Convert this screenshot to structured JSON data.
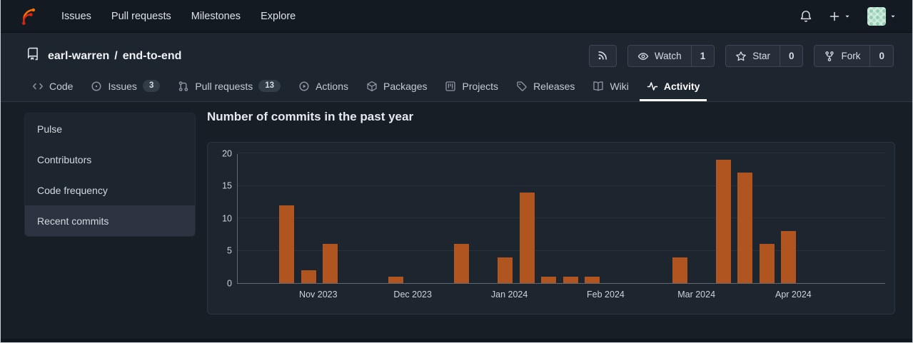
{
  "navbar": {
    "logo_icon": "forgejo-logo-icon",
    "links": [
      {
        "label": "Issues"
      },
      {
        "label": "Pull requests"
      },
      {
        "label": "Milestones"
      },
      {
        "label": "Explore"
      }
    ],
    "right": {
      "bell_icon": "bell-icon",
      "plus_icon": "plus-icon",
      "caret_icon": "chevron-down-icon"
    }
  },
  "repo": {
    "icon": "repo-icon",
    "owner": "earl-warren",
    "divider": "/",
    "name": "end-to-end"
  },
  "repo_actions": {
    "rss_icon": "rss-icon",
    "buttons": [
      {
        "label": "Watch",
        "count": "1",
        "icon": "eye-icon"
      },
      {
        "label": "Star",
        "count": "0",
        "icon": "star-icon"
      },
      {
        "label": "Fork",
        "count": "0",
        "icon": "fork-icon"
      }
    ]
  },
  "tabs": [
    {
      "label": "Code",
      "icon": "code-icon",
      "badge": null,
      "active": false
    },
    {
      "label": "Issues",
      "icon": "issue-circle-icon",
      "badge": "3",
      "active": false
    },
    {
      "label": "Pull requests",
      "icon": "pull-request-icon",
      "badge": "13",
      "active": false
    },
    {
      "label": "Actions",
      "icon": "play-circle-icon",
      "badge": null,
      "active": false
    },
    {
      "label": "Packages",
      "icon": "package-icon",
      "badge": null,
      "active": false
    },
    {
      "label": "Projects",
      "icon": "project-board-icon",
      "badge": null,
      "active": false
    },
    {
      "label": "Releases",
      "icon": "tag-icon",
      "badge": null,
      "active": false
    },
    {
      "label": "Wiki",
      "icon": "book-icon",
      "badge": null,
      "active": false
    },
    {
      "label": "Activity",
      "icon": "pulse-icon",
      "badge": null,
      "active": true
    }
  ],
  "sidebar": {
    "items": [
      {
        "label": "Pulse",
        "active": false
      },
      {
        "label": "Contributors",
        "active": false
      },
      {
        "label": "Code frequency",
        "active": false
      },
      {
        "label": "Recent commits",
        "active": true
      }
    ]
  },
  "chart_data": {
    "type": "bar",
    "title": "Number of commits in the past year",
    "xlabel": "",
    "ylabel": "",
    "ylim": [
      0,
      20
    ],
    "yticks": [
      0,
      5,
      10,
      15,
      20
    ],
    "grid": true,
    "legend_position": "none",
    "x_tick_labels": [
      "Nov 2023",
      "Dec 2023",
      "Jan 2024",
      "Feb 2024",
      "Mar 2024",
      "Apr 2024"
    ],
    "month_week_positions": [
      3.69,
      8.02,
      12.45,
      16.86,
      21.02,
      25.46
    ],
    "total_weeks": 29.7,
    "bar_color": "#b05420",
    "bars": [
      {
        "week": 2,
        "commits": 12
      },
      {
        "week": 3,
        "commits": 2
      },
      {
        "week": 4,
        "commits": 6
      },
      {
        "week": 7,
        "commits": 1
      },
      {
        "week": 10,
        "commits": 6
      },
      {
        "week": 12,
        "commits": 4
      },
      {
        "week": 13,
        "commits": 14
      },
      {
        "week": 14,
        "commits": 1
      },
      {
        "week": 15,
        "commits": 1
      },
      {
        "week": 16,
        "commits": 1
      },
      {
        "week": 20,
        "commits": 4
      },
      {
        "week": 22,
        "commits": 19
      },
      {
        "week": 23,
        "commits": 17
      },
      {
        "week": 24,
        "commits": 6
      },
      {
        "week": 25,
        "commits": 8
      }
    ]
  },
  "colors": {
    "bar": "#b05420",
    "active_tab_underline": "#ffffff",
    "logo_orange": "#ff7000",
    "logo_red": "#d62612",
    "panel_background": "#1d252e",
    "page_background": "#171e26"
  }
}
